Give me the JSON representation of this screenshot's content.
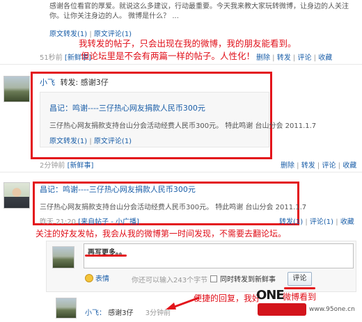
{
  "top_post": {
    "body_line1": "感谢各位看官的厚爱。就说这么多建议，行动最重要。今天我来教大家玩转微博，让身边的人关注",
    "body_line2": "你。让你关注身边的人。  微博是什么？ ...",
    "actions": [
      "原文转发(1)",
      "原文评论(1)"
    ],
    "time": "51秒前",
    "source": "[新鲜事]",
    "right_actions": [
      "删除",
      "转发",
      "评论",
      "收藏"
    ]
  },
  "annotations": {
    "note1_line1": "我转发的帖子，只会出现在我的微博，我的朋友能看到。",
    "note1_line2": "但论坛里是不会有两篇一样的帖子。人性化！",
    "note2": "关注的好友发帖，我会从我的微博第一时间发现，不需要去翻论坛。",
    "note3_a": "便捷的回复，我好",
    "note3_b": "微博看到",
    "watermark": "www.95one.cn"
  },
  "repost": {
    "user": "小飞",
    "prefix": "转发:",
    "text": "感谢3仔",
    "orig_title": "昌记：鸣谢----三仔热心网友捐款人民币300元",
    "orig_body": "三仔热心网友捐款支持台山分会活动经费人民币300元。  特此鸣谢 台山分会 2011.1.7",
    "orig_actions": [
      "原文转发(1)",
      "原文评论(1)"
    ],
    "time": "2分钟前",
    "source": "[新鲜事]",
    "right_actions": [
      "删除",
      "转发",
      "评论",
      "收藏"
    ]
  },
  "post2": {
    "title": "昌记：鸣谢----三仔热心网友捐款人民币300元",
    "body": "三仔热心网友捐款支持台山分会活动经费人民币300元。  特此鸣谢 台山分会 2011.1.7",
    "time": "昨天 21:20",
    "source": "[来自帖子 - 小广播]",
    "right_actions": [
      "转发(1)",
      "评论(1)",
      "收藏"
    ]
  },
  "comment_box": {
    "text": "再写更多。。",
    "emoji_label": "表情",
    "counter": "你还可以输入243个字节",
    "repost_option": "同时转发到新鲜事",
    "submit_label": "评论"
  },
  "reply": {
    "user": "小飞：",
    "text": "感谢3仔",
    "time": "3分钟前"
  }
}
